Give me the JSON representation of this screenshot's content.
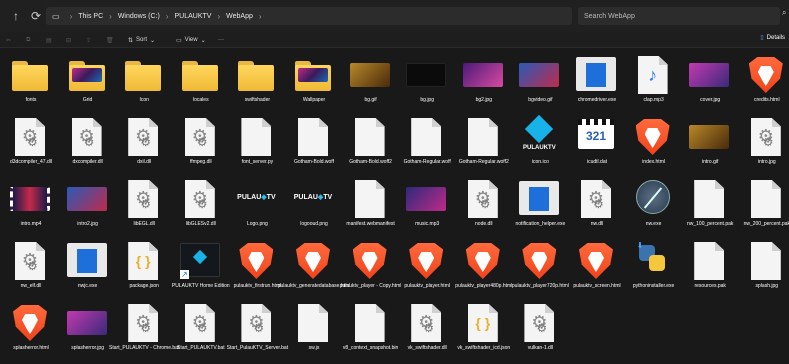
{
  "address": {
    "parts": [
      "This PC",
      "Windows (C:)",
      "PULAUKTV",
      "WebApp"
    ]
  },
  "search": {
    "placeholder": "Search WebApp"
  },
  "toolbar": {
    "sort": "Sort",
    "view": "View",
    "more": "···",
    "details": "Details"
  },
  "colors": {
    "background": "#191919",
    "folder": "#f6c343",
    "brave": "#fb542b",
    "accent": "#4aa3ff"
  },
  "files": [
    {
      "name": "fonts",
      "icon": "folder"
    },
    {
      "name": "Grid",
      "icon": "folder-image"
    },
    {
      "name": "Icon",
      "icon": "folder"
    },
    {
      "name": "locales",
      "icon": "folder"
    },
    {
      "name": "swiftshader",
      "icon": "folder"
    },
    {
      "name": "Wallpaper",
      "icon": "folder-image"
    },
    {
      "name": "bg.gif",
      "icon": "image-thumb"
    },
    {
      "name": "bg.jpg",
      "icon": "image-dark"
    },
    {
      "name": "bg2.jpg",
      "icon": "image-thumb"
    },
    {
      "name": "bgvideo.gif",
      "icon": "image-thumb"
    },
    {
      "name": "chromedriver.exe",
      "icon": "exe-window"
    },
    {
      "name": "clap.mp3",
      "icon": "music-note-icon"
    },
    {
      "name": "cover.jpg",
      "icon": "image-thumb"
    },
    {
      "name": "credits.html",
      "icon": "brave-icon"
    },
    {
      "name": "d3dcompiler_47.dll",
      "icon": "gear-file-icon"
    },
    {
      "name": "dxcompiler.dll",
      "icon": "gear-file-icon"
    },
    {
      "name": "dxil.dll",
      "icon": "gear-file-icon"
    },
    {
      "name": "ffmpeg.dll",
      "icon": "gear-file-icon"
    },
    {
      "name": "font_server.py",
      "icon": "blank-file-icon"
    },
    {
      "name": "Gotham-Bold.woff",
      "icon": "blank-file-icon"
    },
    {
      "name": "Gotham-Bold.woff2",
      "icon": "blank-file-icon"
    },
    {
      "name": "Gotham-Regular.woff",
      "icon": "blank-file-icon"
    },
    {
      "name": "Gotham-Regular.woff2",
      "icon": "blank-file-icon"
    },
    {
      "name": "icon.ico",
      "icon": "kodi-icon"
    },
    {
      "name": "icudtl.dat",
      "icon": "clapper-icon"
    },
    {
      "name": "index.html",
      "icon": "brave-icon"
    },
    {
      "name": "intro.gif",
      "icon": "image-thumb"
    },
    {
      "name": "intro.jpg",
      "icon": "gear-file-icon"
    },
    {
      "name": "intro.mp4",
      "icon": "video-thumb"
    },
    {
      "name": "intro2.jpg",
      "icon": "image-thumb"
    },
    {
      "name": "libEGL.dll",
      "icon": "gear-file-icon"
    },
    {
      "name": "libGLESv2.dll",
      "icon": "gear-file-icon"
    },
    {
      "name": "Logo.png",
      "icon": "logo-thumb"
    },
    {
      "name": "logooud.png",
      "icon": "logo-thumb"
    },
    {
      "name": "manifest.webmanifest",
      "icon": "blank-file-icon"
    },
    {
      "name": "music.mp3",
      "icon": "image-thumb"
    },
    {
      "name": "node.dll",
      "icon": "gear-file-icon"
    },
    {
      "name": "notification_helper.exe",
      "icon": "exe-window"
    },
    {
      "name": "nw.dll",
      "icon": "gear-file-icon"
    },
    {
      "name": "nw.exe",
      "icon": "compass-icon"
    },
    {
      "name": "nw_100_percent.pak",
      "icon": "blank-file-icon"
    },
    {
      "name": "nw_200_percent.pak",
      "icon": "blank-file-icon"
    },
    {
      "name": "nw_elf.dll",
      "icon": "gear-file-icon"
    },
    {
      "name": "nwjc.exe",
      "icon": "exe-window"
    },
    {
      "name": "package.json",
      "icon": "json-file-icon"
    },
    {
      "name": "PULAUKTV Home Edition",
      "icon": "shortcut-thumb"
    },
    {
      "name": "pulauktv_firstrun.html",
      "icon": "brave-icon"
    },
    {
      "name": "pulauktv_generatedatabase.html",
      "icon": "brave-icon"
    },
    {
      "name": "pulauktv_player - Copy.html",
      "icon": "brave-icon"
    },
    {
      "name": "pulauktv_player.html",
      "icon": "brave-icon"
    },
    {
      "name": "pulauktv_player480p.html",
      "icon": "brave-icon"
    },
    {
      "name": "pulauktv_player720p.html",
      "icon": "brave-icon"
    },
    {
      "name": "pulauktv_screen.html",
      "icon": "brave-icon"
    },
    {
      "name": "pythoninstaller.exe",
      "icon": "python-icon"
    },
    {
      "name": "resources.pak",
      "icon": "blank-file-icon"
    },
    {
      "name": "splash.jpg",
      "icon": "blank-file-icon"
    },
    {
      "name": "splasherror.html",
      "icon": "brave-icon"
    },
    {
      "name": "splasherror.jpg",
      "icon": "image-thumb"
    },
    {
      "name": "Start_PULAUKTV - Chrome.bat",
      "icon": "gear-file-icon"
    },
    {
      "name": "Start_PULAUKTV.bat",
      "icon": "gear-file-icon"
    },
    {
      "name": "Start_PulauKTV_Server.bat",
      "icon": "gear-file-icon"
    },
    {
      "name": "sw.js",
      "icon": "blank-file-icon"
    },
    {
      "name": "v8_context_snapshot.bin",
      "icon": "blank-file-icon"
    },
    {
      "name": "vk_swiftshader.dll",
      "icon": "gear-file-icon"
    },
    {
      "name": "vk_swiftshader_icd.json",
      "icon": "json-file-icon"
    },
    {
      "name": "vulkan-1.dll",
      "icon": "gear-file-icon"
    }
  ]
}
